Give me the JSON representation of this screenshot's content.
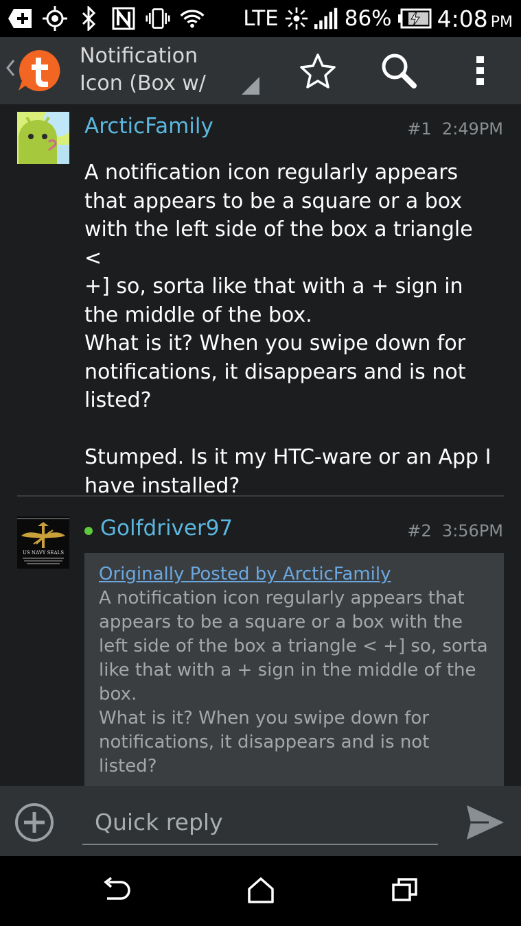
{
  "status_bar": {
    "lte_label": "LTE",
    "battery_percent": "86%",
    "time": "4:08",
    "ampm": "PM",
    "icons": [
      "add-box-icon",
      "gps-icon",
      "bluetooth-icon",
      "nfc-icon",
      "vibrate-icon",
      "wifi-icon",
      "data-activity-icon",
      "signal-icon",
      "battery-charging-icon"
    ]
  },
  "action_bar": {
    "title": "Notification\nIcon (Box w/",
    "app_icon": "tapatalk-logo",
    "buttons": [
      "star-icon",
      "search-icon",
      "overflow-menu-icon"
    ]
  },
  "posts": [
    {
      "username": "ArcticFamily",
      "number": "#1",
      "time": "2:49PM",
      "body": "A notification icon regularly appears that appears to be a square or a box with the left side of the box a triangle <\n+] so, sorta like that with a + sign in the middle of the box.\nWhat is it? When you swipe down for notifications, it disappears and is not listed?\n\nStumped. Is it my HTC-ware or an App I have installed?"
    },
    {
      "username": "Golfdriver97",
      "online": true,
      "number": "#2",
      "time": "3:56PM",
      "avatar_caption": "US NAVY SEALS",
      "quote_source": "Originally Posted by ArcticFamily",
      "quote_body": "A notification icon regularly appears that appears to be a square or a box with the left side of the box a triangle < +] so, sorta like that with a + sign in the middle of the box.\nWhat is it? When you swipe down for notifications, it disappears and is not listed?\n\nStumped. Is it my HTC-ware or an App I have installed?"
    }
  ],
  "reply_bar": {
    "placeholder": "Quick reply"
  },
  "colors": {
    "accent": "#5bb7df",
    "online": "#5ec93a",
    "link": "#6ca8e0",
    "brand": "#f26522"
  }
}
